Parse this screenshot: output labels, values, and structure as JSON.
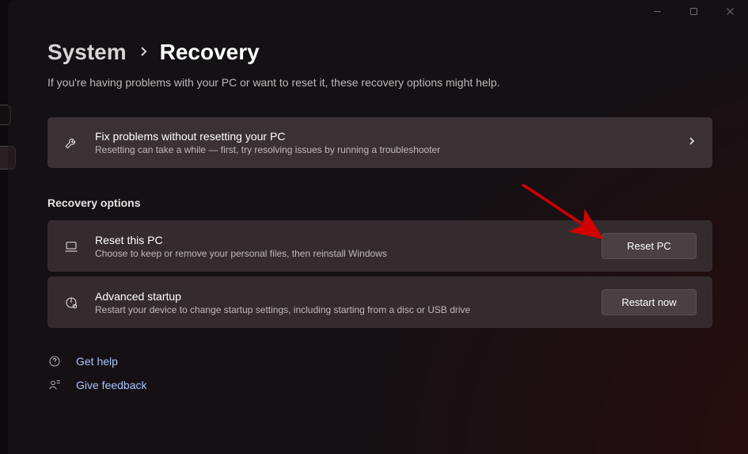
{
  "breadcrumb": {
    "parent": "System",
    "current": "Recovery"
  },
  "subtitle": "If you're having problems with your PC or want to reset it, these recovery options might help.",
  "fix_card": {
    "title": "Fix problems without resetting your PC",
    "desc": "Resetting can take a while — first, try resolving issues by running a troubleshooter"
  },
  "section_heading": "Recovery options",
  "reset_card": {
    "title": "Reset this PC",
    "desc": "Choose to keep or remove your personal files, then reinstall Windows",
    "button": "Reset PC"
  },
  "advanced_card": {
    "title": "Advanced startup",
    "desc": "Restart your device to change startup settings, including starting from a disc or USB drive",
    "button": "Restart now"
  },
  "footer": {
    "help": "Get help",
    "feedback": "Give feedback"
  }
}
